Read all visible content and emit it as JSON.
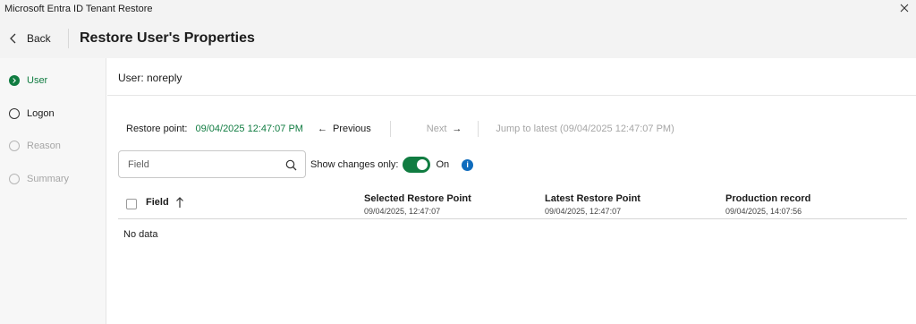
{
  "window": {
    "title": "Microsoft Entra ID Tenant Restore",
    "close_icon": "close-icon"
  },
  "header": {
    "back_label": "Back",
    "page_title": "Restore User's Properties"
  },
  "steps": [
    {
      "label": "User",
      "state": "active"
    },
    {
      "label": "Logon",
      "state": "pending"
    },
    {
      "label": "Reason",
      "state": "disabled"
    },
    {
      "label": "Summary",
      "state": "disabled"
    }
  ],
  "user": {
    "label": "User: noreply"
  },
  "restore": {
    "label": "Restore point:",
    "value": "09/04/2025 12:47:07 PM",
    "previous_label": "Previous",
    "next_label": "Next",
    "jump_label": "Jump to latest (09/04/2025 12:47:07 PM)"
  },
  "search": {
    "placeholder": "Field",
    "value": ""
  },
  "toggle": {
    "label": "Show changes only:",
    "state_label": "On",
    "checked": true
  },
  "table": {
    "columns": [
      {
        "header": "Field"
      },
      {
        "header": "Selected Restore Point",
        "subtext": "09/04/2025, 12:47:07"
      },
      {
        "header": "Latest Restore Point",
        "subtext": "09/04/2025, 12:47:07"
      },
      {
        "header": "Production record",
        "subtext": "09/04/2025, 14:07:56"
      }
    ],
    "empty_text": "No data"
  },
  "colors": {
    "accent": "#107c41",
    "info": "#0f6cbd",
    "disabled": "#a6a6a6"
  }
}
